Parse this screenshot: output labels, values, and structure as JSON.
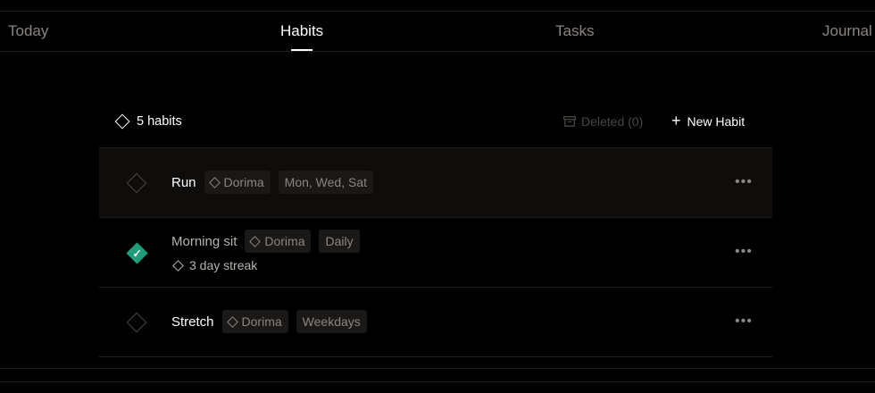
{
  "tabs": [
    {
      "label": "Today",
      "active": false
    },
    {
      "label": "Habits",
      "active": true
    },
    {
      "label": "Tasks",
      "active": false
    },
    {
      "label": "Journal",
      "active": false
    }
  ],
  "header": {
    "count_label": "5 habits",
    "deleted_label": "Deleted (0)",
    "new_habit_label": "New Habit"
  },
  "habits": [
    {
      "title": "Run",
      "tag": "Dorima",
      "schedule": "Mon, Wed, Sat",
      "done": false
    },
    {
      "title": "Morning sit",
      "tag": "Dorima",
      "schedule": "Daily",
      "done": true,
      "streak": "3 day streak"
    },
    {
      "title": "Stretch",
      "tag": "Dorima",
      "schedule": "Weekdays",
      "done": false
    }
  ],
  "more_label": "•••",
  "check_glyph": "✓",
  "colors": {
    "accent": "#1f9d7a",
    "background": "#000000",
    "muted": "#8a8580"
  }
}
